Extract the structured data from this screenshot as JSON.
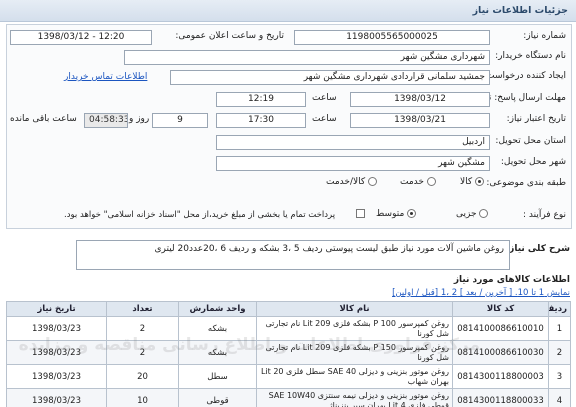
{
  "header": {
    "title": "جزئیات اطلاعات نیاز"
  },
  "form": {
    "need_number_label": "شماره نیاز:",
    "need_number": "1198005565000025",
    "announce_datetime_label": "تاریخ و ساعت اعلان عمومی:",
    "announce_datetime": "1398/03/12 - 12:20",
    "buyer_org_label": "نام دستگاه خریدار:",
    "buyer_org": "شهرداری مشگین شهر",
    "requester_label": "ایجاد کننده درخواست:",
    "requester": "جمشید سلمانی قراردادی شهرداری مشگین شهر",
    "buyer_contact_link": "اطلاعات تماس خریدار",
    "send_deadline_label": "مهلت ارسال پاسخ: تا تاریخ:",
    "send_deadline_date": "1398/03/12",
    "send_deadline_time_label": "ساعت",
    "send_deadline_time": "12:19",
    "validity_label": "تاریخ اعتبار نیاز:",
    "validity_date": "1398/03/21",
    "validity_time_label": "ساعت",
    "validity_time": "17:30",
    "days": "9",
    "days_label": "روز و",
    "remaining_time": "04:58:33",
    "remaining_label": "ساعت باقی مانده",
    "province_label": "استان محل تحویل:",
    "province": "اردبیل",
    "city_label": "شهر محل تحویل:",
    "city": "مشگین شهر",
    "category_label": "طبقه بندی موضوعی:",
    "category_options": [
      "کالا",
      "خدمت",
      "کالا/خدمت"
    ],
    "category_selected": "کالا",
    "process_label": "نوع فرآیند :",
    "process_options": [
      "جزیی",
      "متوسط"
    ],
    "process_selected": "متوسط",
    "payment_note": "پرداخت تمام یا بخشی از مبلغ خرید،از محل \"اسناد خزانه اسلامی\" خواهد بود."
  },
  "description": {
    "label": "شرح کلی نیاز:",
    "text": "روغن ماشین آلات مورد نیاز طبق لیست پیوستی ردیف 5 ،3 بشکه و ردیف 6 ،20عدد20 لیتری"
  },
  "items": {
    "title": "اطلاعات کالاهای مورد نیاز",
    "pager": "نمایش 1 تا 10. [ آخرین / بعد ] 2 ،1 [قبل / اولین]",
    "columns": [
      "ردیف",
      "کد کالا",
      "نام کالا",
      "واحد شمارش",
      "تعداد",
      "تاریخ نیاز"
    ],
    "rows": [
      {
        "row": "1",
        "code": "0814100086610010",
        "name": "روغن کمپرسور P 100 بشکه فلزی 209 Lit نام تجارتی شل کورنا",
        "unit": "بشکه",
        "qty": "2",
        "date": "1398/03/23"
      },
      {
        "row": "2",
        "code": "0814100086610030",
        "name": "روغن کمپرسور P 150 بشکه فلزی 209 Lit نام تجارتی شل کورنا",
        "unit": "بشکه",
        "qty": "2",
        "date": "1398/03/23"
      },
      {
        "row": "3",
        "code": "0814300118800003",
        "name": "روغن موتور بنزینی و دیزلی SAE 40 سطل فلزی 20 Lit بهران شهاب",
        "unit": "سطل",
        "qty": "20",
        "date": "1398/03/23"
      },
      {
        "row": "4",
        "code": "0814300118800033",
        "name": "روغن موتور بنزینی و دیزلی نیمه سنتزی SAE 10W40 قوطی فلزی 4 Lit بهران سپر بنزیناژ",
        "unit": "قوطی",
        "qty": "10",
        "date": "1398/03/23"
      }
    ]
  },
  "watermark": "مرکز فراوری اطلاعات و اطلاع رسانی مناقصه و مزایده",
  "watermark_number": "021-88346",
  "colors": {
    "link": "#1b55c0",
    "header_bg": "#d4dfec"
  }
}
